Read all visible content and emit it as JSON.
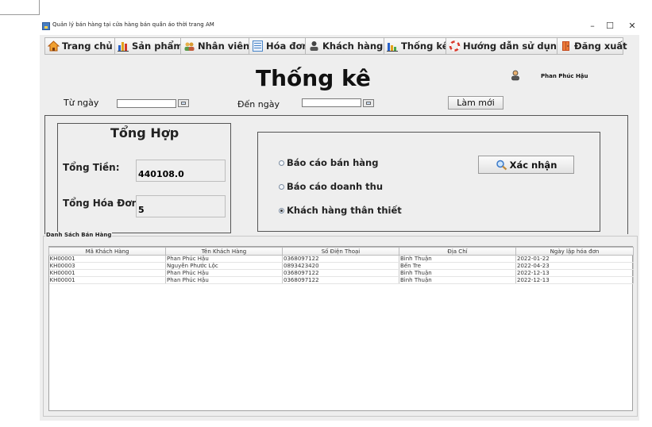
{
  "window": {
    "title": "Quản lý bán hàng tại cửa hàng bán quần áo thời trang AM",
    "minimize": "–",
    "maximize": "☐",
    "close": "✕"
  },
  "nav": [
    {
      "label": "Trang chủ",
      "icon": "home-icon",
      "color": "#e07b1a"
    },
    {
      "label": "Sản phẩm",
      "icon": "products-icon",
      "color": "#2a62c9"
    },
    {
      "label": "Nhân viên",
      "icon": "employees-icon",
      "color": "#c2a03a"
    },
    {
      "label": "Hóa đơn",
      "icon": "invoice-icon",
      "color": "#4a86c8"
    },
    {
      "label": "Khách hàng",
      "icon": "customer-icon",
      "color": "#555555"
    },
    {
      "label": "Thống kê",
      "icon": "statistics-icon",
      "color": "#2a62c9"
    },
    {
      "label": "Hướng dẫn sử dụng",
      "icon": "help-icon",
      "color": "#d9382b"
    },
    {
      "label": "Đăng xuất",
      "icon": "logout-icon",
      "color": "#c44a1e"
    }
  ],
  "header": {
    "title": "Thống kê",
    "user_name": "Phan Phúc Hậu"
  },
  "filters": {
    "from_label": "Từ ngày",
    "to_label": "Đến ngày",
    "from_value": "",
    "to_value": "",
    "refresh_button": "Làm mới"
  },
  "summary": {
    "title": "Tổng Hợp",
    "total_amount_label": "Tổng Tiền:",
    "total_amount_value": "440108.0",
    "total_invoices_label": "Tổng Hóa Đơn",
    "total_invoices_value": "5"
  },
  "report": {
    "options": [
      {
        "label": "Báo cáo bán hàng",
        "selected": false
      },
      {
        "label": "Báo cáo doanh thu",
        "selected": false
      },
      {
        "label": "Khách hàng thân thiết",
        "selected": true
      }
    ],
    "confirm_button": "Xác nhận"
  },
  "table": {
    "group_title": "Danh Sách Bán Hàng",
    "columns": [
      "Mã Khách Hàng",
      "Tên Khách Hàng",
      "Số Điện Thoại",
      "Địa Chỉ",
      "Ngày lập hóa đơn"
    ],
    "rows": [
      [
        "KH00001",
        "Phan Phúc Hậu",
        "0368097122",
        "Bình Thuận",
        "2022-01-22"
      ],
      [
        "KH00003",
        "Nguyễn Phước Lộc",
        "0893423420",
        "Bến Tre",
        "2022-04-23"
      ],
      [
        "KH00001",
        "Phan Phúc Hậu",
        "0368097122",
        "Bình Thuận",
        "2022-12-13"
      ],
      [
        "KH00001",
        "Phan Phúc Hậu",
        "0368097122",
        "Bình Thuận",
        "2022-12-13"
      ]
    ]
  }
}
